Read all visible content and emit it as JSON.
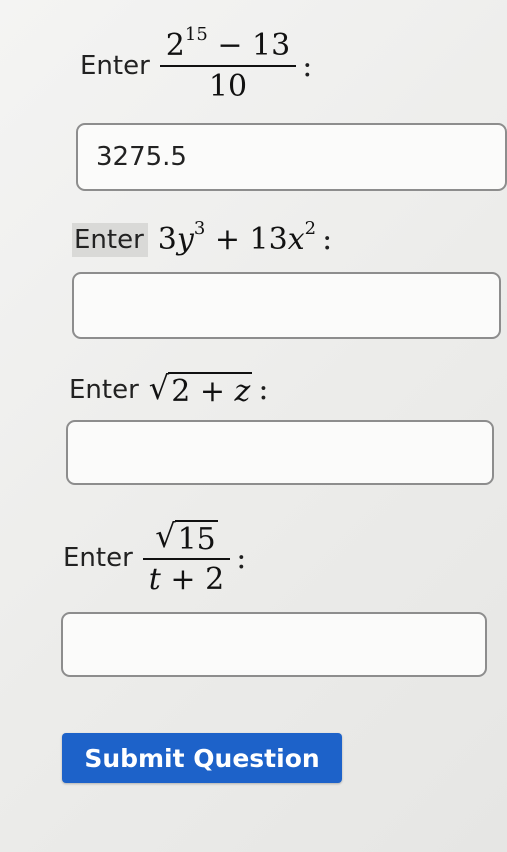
{
  "questions": [
    {
      "prompt": "Enter",
      "expr": {
        "numerator_base": "2",
        "numerator_exp": "15",
        "numerator_rest": "− 13",
        "denominator": "10"
      },
      "colon": ":",
      "answer_value": "3275.5"
    },
    {
      "prompt": "Enter",
      "expr": {
        "coef1": "3",
        "var1": "y",
        "exp1": "3",
        "op": "+",
        "coef2": "13",
        "var2": "x",
        "exp2": "2"
      },
      "colon": ":",
      "answer_value": ""
    },
    {
      "prompt": "Enter",
      "expr": {
        "radicand_num": "2",
        "op": "+",
        "var": "z"
      },
      "colon": ":",
      "answer_value": ""
    },
    {
      "prompt": "Enter",
      "expr": {
        "numerator_radicand": "15",
        "denominator_var": "t",
        "denominator_op": "+",
        "denominator_num": "2"
      },
      "colon": ":",
      "answer_value": ""
    }
  ],
  "submit_label": "Submit Question"
}
